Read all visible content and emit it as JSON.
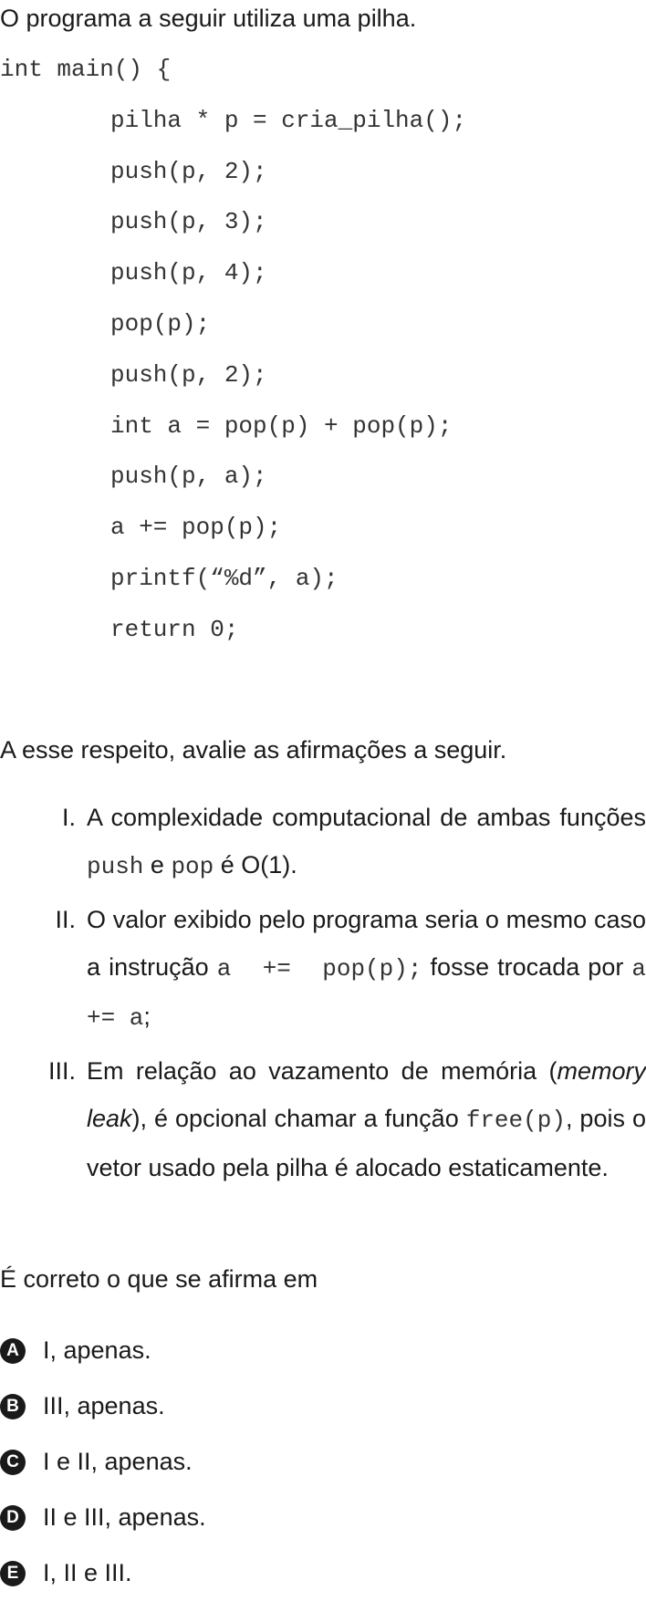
{
  "intro": "O programa a seguir utiliza uma pilha.",
  "code_lines": [
    "int main() {",
    "pilha * p = cria_pilha();",
    "push(p, 2);",
    "push(p, 3);",
    "push(p, 4);",
    "pop(p);",
    "push(p, 2);",
    "int a = pop(p) + pop(p);",
    "push(p, a);",
    "a += pop(p);",
    "printf(“%d”, a);",
    "return 0;"
  ],
  "prompt": "A esse respeito, avalie as afirmações a seguir.",
  "statements": {
    "s1": {
      "num": "I.",
      "t1": "A complexidade computacional de ambas funções ",
      "c1": "push",
      "t2": " e ",
      "c2": "pop",
      "t3": " é O(1)."
    },
    "s2": {
      "num": "II.",
      "t1": "O valor exibido pelo programa seria o mesmo caso a instrução ",
      "c1": "a  +=  pop(p);",
      "t2": " fosse trocada por ",
      "c2": "a += a",
      "t3": ";"
    },
    "s3": {
      "num": "III.",
      "t1": "Em relação ao vazamento de memória (",
      "em": "memory leak",
      "t2": "), é opcional chamar a função ",
      "c1": "free(p)",
      "t3": ", pois o vetor usado pela pilha é alocado estaticamente."
    }
  },
  "question": "É correto o que se afirma em",
  "options": [
    {
      "letter": "A",
      "text": "I, apenas."
    },
    {
      "letter": "B",
      "text": "III, apenas."
    },
    {
      "letter": "C",
      "text": "I e II, apenas."
    },
    {
      "letter": "D",
      "text": "II e III, apenas."
    },
    {
      "letter": "E",
      "text": "I, II e III."
    }
  ]
}
